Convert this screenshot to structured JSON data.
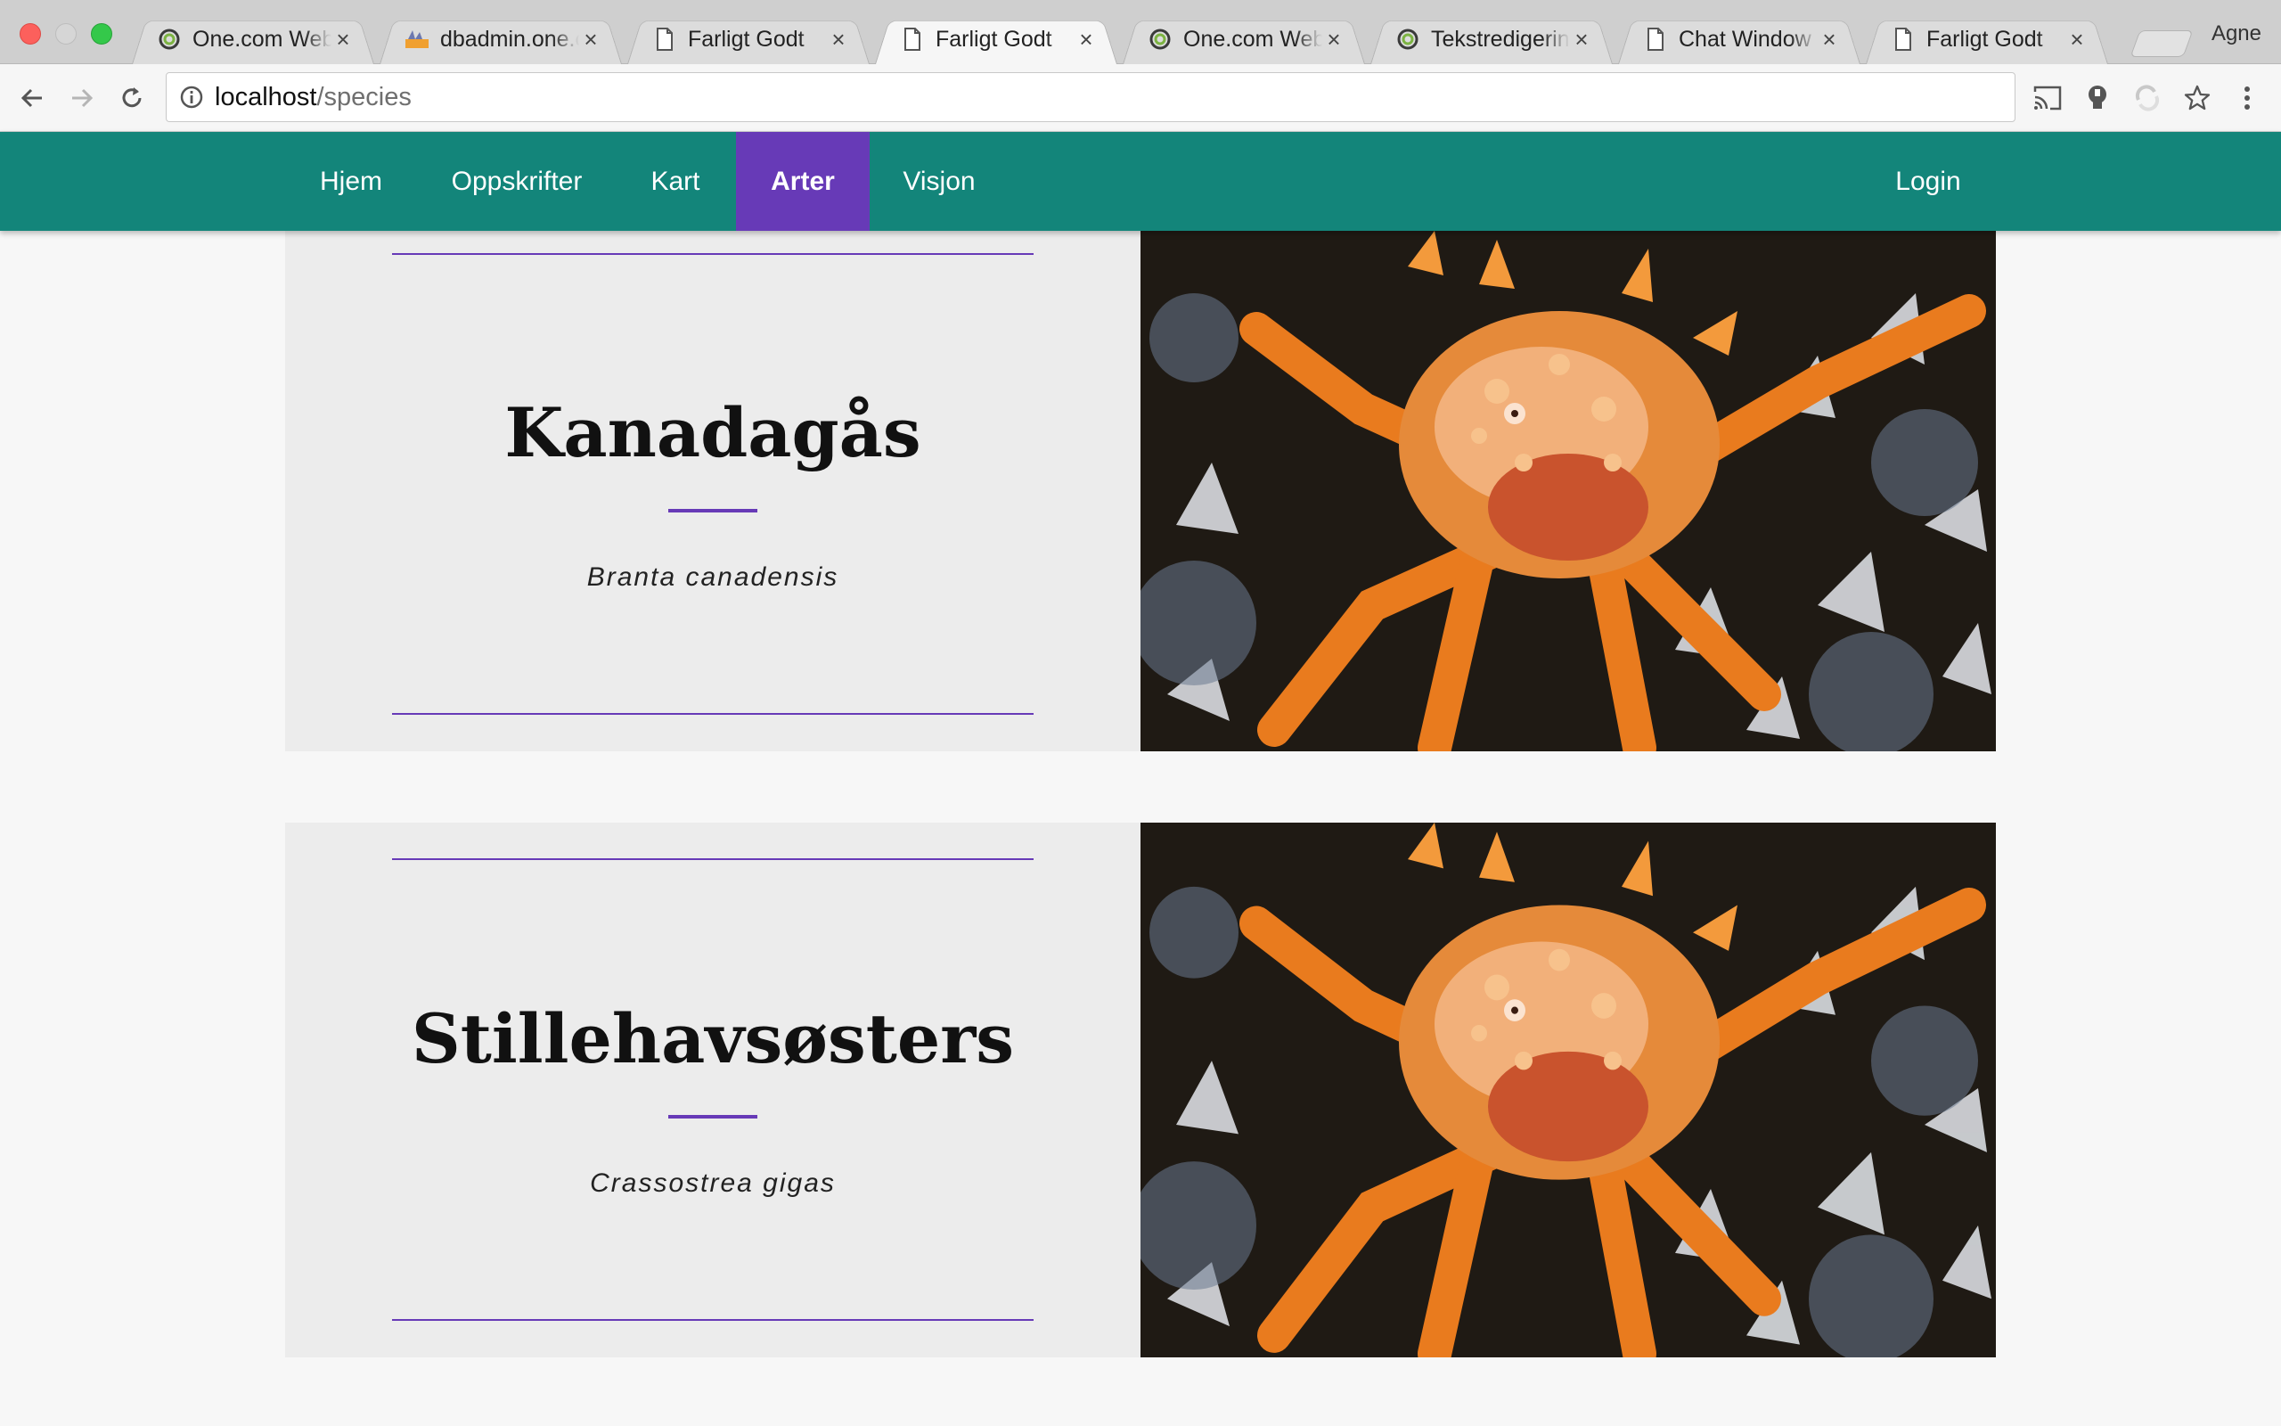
{
  "browser": {
    "tabs": [
      {
        "title": "One.com Webhosting",
        "icon": "onecom-icon",
        "active": false
      },
      {
        "title": "dbadmin.one.com",
        "icon": "phpmyadmin-icon",
        "active": false
      },
      {
        "title": "Farligt Godt",
        "icon": "document-icon",
        "active": false
      },
      {
        "title": "Farligt Godt",
        "icon": "document-icon",
        "active": true
      },
      {
        "title": "One.com Webhosting",
        "icon": "onecom-icon",
        "active": false
      },
      {
        "title": "Tekstredigering",
        "icon": "onecom-icon",
        "active": false
      },
      {
        "title": "Chat Window",
        "icon": "document-icon",
        "active": false
      },
      {
        "title": "Farligt Godt",
        "icon": "document-icon",
        "active": false
      }
    ],
    "profile_name": "Agne",
    "url_host": "localhost",
    "url_path": "/species"
  },
  "nav": {
    "links": [
      {
        "label": "Hjem",
        "active": false
      },
      {
        "label": "Oppskrifter",
        "active": false
      },
      {
        "label": "Kart",
        "active": false
      },
      {
        "label": "Arter",
        "active": true
      },
      {
        "label": "Visjon",
        "active": false
      }
    ],
    "login": "Login"
  },
  "species": [
    {
      "name": "Kanadagås",
      "latin": "Branta canadensis",
      "image": "king-crab-photo"
    },
    {
      "name": "Stillehavsøsters",
      "latin": "Crassostrea gigas",
      "image": "king-crab-photo"
    }
  ],
  "colors": {
    "nav_bg": "#13857a",
    "nav_active": "#673ab7",
    "accent_rule": "#673ab7",
    "card_bg": "#ececec",
    "page_bg": "#f7f7f7"
  }
}
